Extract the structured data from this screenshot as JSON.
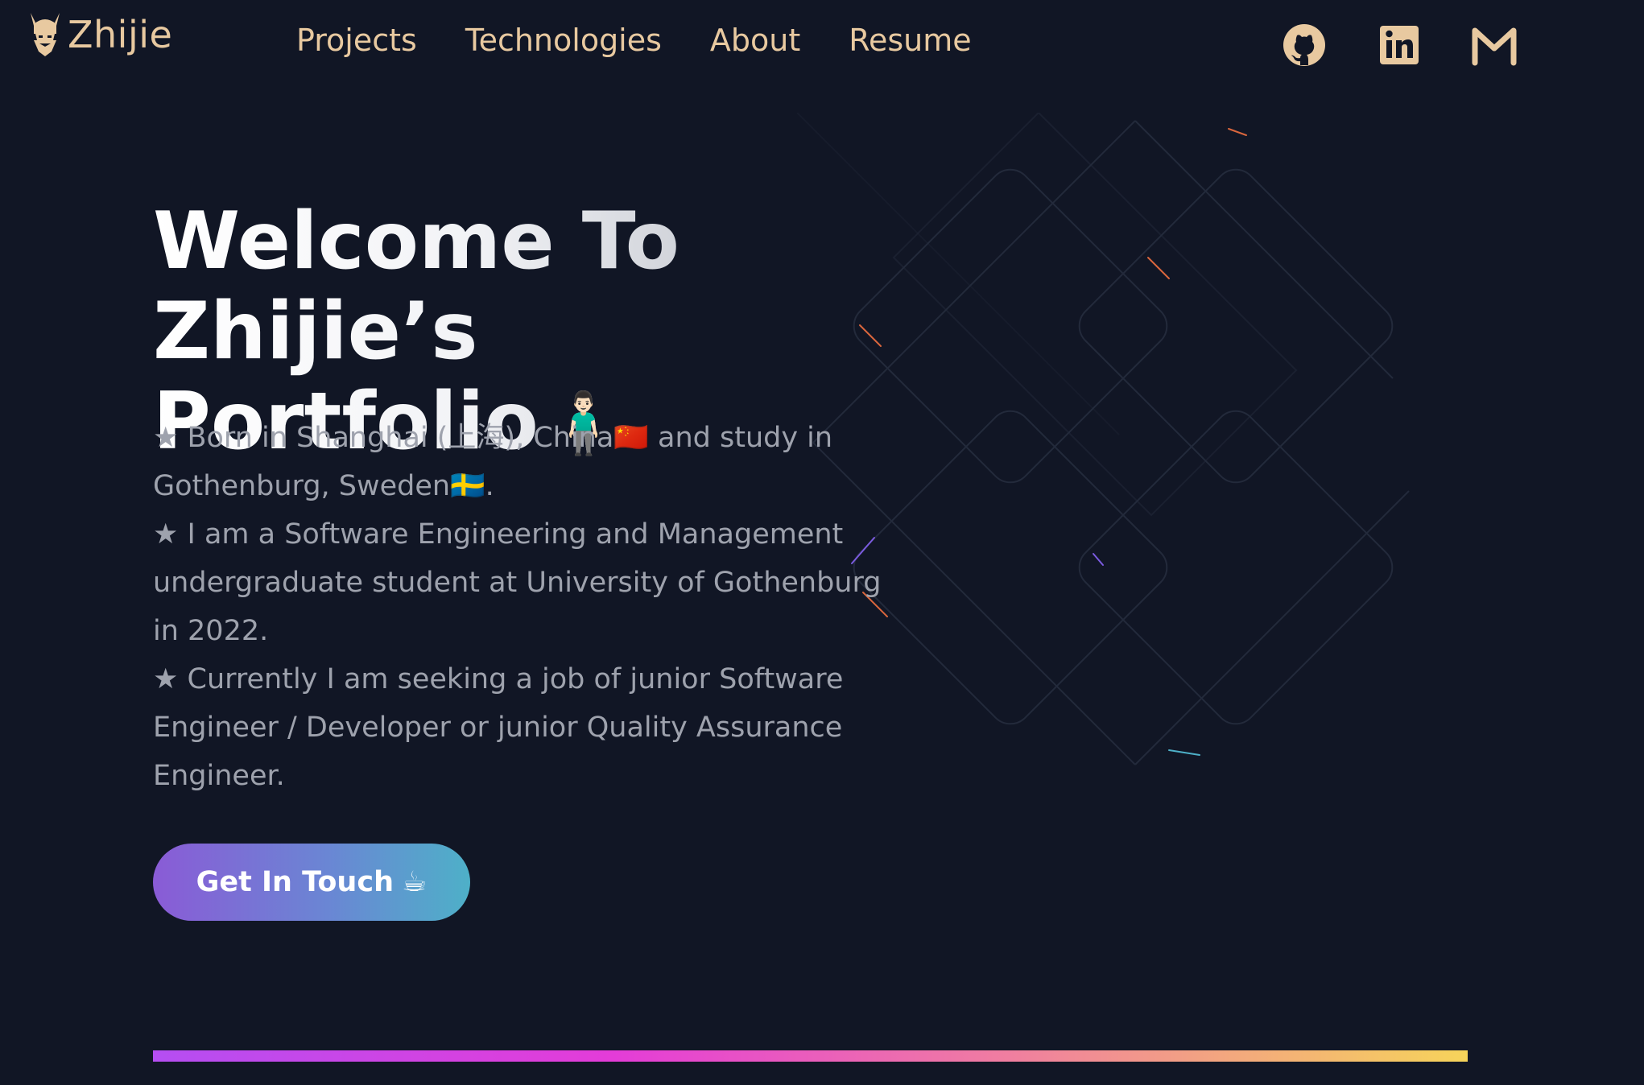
{
  "header": {
    "logo_text": "Zhijie",
    "nav": [
      {
        "label": "Projects"
      },
      {
        "label": "Technologies"
      },
      {
        "label": "About"
      },
      {
        "label": "Resume"
      }
    ],
    "socials": [
      {
        "name": "github-icon"
      },
      {
        "name": "linkedin-icon"
      },
      {
        "name": "mail-icon"
      }
    ]
  },
  "hero": {
    "title_line1": "Welcome To Zhijie’s",
    "title_line2": "Portfolio",
    "title_emoji": "🧍🏻‍♂️",
    "paragraphs": [
      "★ Born in Shanghai (上海), China🇨🇳 and study in Gothenburg, Sweden🇸🇪.",
      "★ I am a Software Engineering and Management undergraduate student at University of Gothenburg in 2022.",
      "★ Currently I am seeking a job of junior Software Engineer / Developer or junior Quality Assurance Engineer."
    ],
    "cta_label": "Get In Touch",
    "cta_emoji": "☕"
  },
  "colors": {
    "background": "#111625",
    "accent": "#e8c9a0",
    "text_muted": "#9ea2ad",
    "cta_gradient_start": "#8a5bd6",
    "cta_gradient_end": "#4eb0c8"
  }
}
